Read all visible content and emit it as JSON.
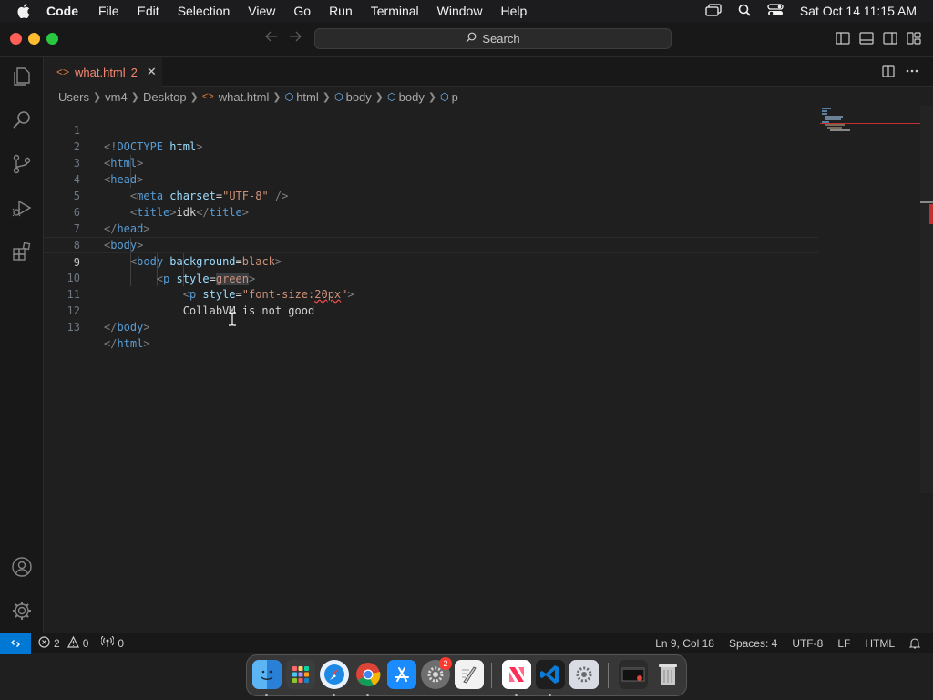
{
  "menubar": {
    "app_name": "Code",
    "items": [
      "File",
      "Edit",
      "Selection",
      "View",
      "Go",
      "Run",
      "Terminal",
      "Window",
      "Help"
    ],
    "clock": "Sat Oct 14  11:15 AM"
  },
  "titlebar": {
    "search_label": "Search"
  },
  "tab": {
    "label": "what.html",
    "problem_count": "2",
    "close_glyph": "✕"
  },
  "breadcrumb": {
    "items": [
      "Users",
      "vm4",
      "Desktop",
      "what.html",
      "html",
      "body",
      "body",
      "p"
    ]
  },
  "editor": {
    "current_line": 9,
    "lines": [
      {
        "n": "1",
        "code": "<!DOCTYPE html>"
      },
      {
        "n": "2",
        "code": "<html>"
      },
      {
        "n": "3",
        "code": "<head>"
      },
      {
        "n": "4",
        "code": "    <meta charset=\"UTF-8\" />"
      },
      {
        "n": "5",
        "code": "    <title>idk</title>"
      },
      {
        "n": "6",
        "code": "</head>"
      },
      {
        "n": "7",
        "code": "<body>"
      },
      {
        "n": "8",
        "code": "    <body background=black>"
      },
      {
        "n": "9",
        "code": "        <p style=green>"
      },
      {
        "n": "10",
        "code": "            <p style=\"font-size:20px\">"
      },
      {
        "n": "11",
        "code": "            CollabVM is not good"
      },
      {
        "n": "12",
        "code": "</body>"
      },
      {
        "n": "13",
        "code": "</html>"
      }
    ]
  },
  "statusbar": {
    "errors": "2",
    "warnings": "0",
    "ports": "0",
    "cursor_position": "Ln 9, Col 18",
    "indentation": "Spaces: 4",
    "encoding": "UTF-8",
    "eol": "LF",
    "language": "HTML"
  },
  "dock": {
    "apps": [
      "Finder",
      "Launchpad",
      "Safari",
      "Chrome",
      "App Store",
      "System Settings",
      "TextEdit",
      "News",
      "Visual Studio Code",
      "Preferences",
      "Window Preview",
      "Trash"
    ],
    "settings_badge": "2"
  },
  "colors": {
    "accent": "#0078d4",
    "editor_bg": "#1f1f1f",
    "error": "#f14c4c"
  }
}
